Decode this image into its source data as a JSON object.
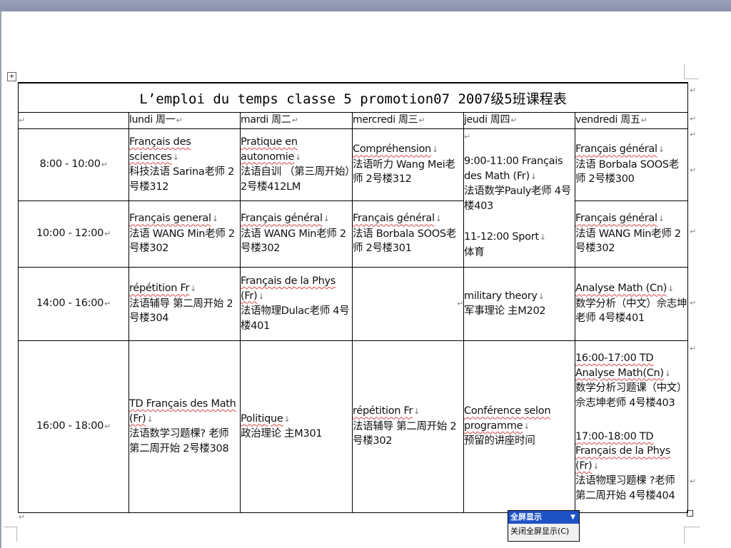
{
  "title": "L’emploi du temps classe 5 promotion07  2007级5班课程表",
  "days": [
    "lundi 周一",
    "mardi 周二",
    "mercredi 周三",
    "jeudi 周四",
    "vendredi 周五"
  ],
  "times": [
    "8:00 - 10:00",
    "10:00 - 12:00",
    "14:00 - 16:00",
    "16:00 - 18:00"
  ],
  "rows": [
    {
      "lundi": [
        "Français des sciences",
        "科技法语 Sarina老师 2号楼312"
      ],
      "mardi": [
        "Pratique en autonomie",
        "法语自训 （第三周开始）2号楼412LM"
      ],
      "mercredi": [
        "Compréhension",
        "法语听力 Wang Mei老师 2号楼312"
      ],
      "vendredi": [
        "Français général",
        "法语 Borbala SOOS老师 2号楼300"
      ]
    },
    {
      "lundi": [
        "Français general",
        "法语 WANG Min老师 2号楼302"
      ],
      "mardi": [
        "Français général",
        "法语 WANG Min老师 2号楼302"
      ],
      "mercredi": [
        "Français général",
        "法语 Borbala SOOS老师 2号楼301"
      ],
      "vendredi": [
        "Français général",
        "法语 WANG Min老师 2号楼302"
      ]
    },
    {
      "lundi": [
        "répétition Fr",
        "法语辅导 第二周开始 2号楼304"
      ],
      "mardi": [
        "Français de la Phys (Fr)",
        "法语物理Dulac老师 4号楼401"
      ],
      "mercredi": [
        "",
        ""
      ],
      "jeudi": [
        "military theory",
        "军事理论 主M202"
      ],
      "vendredi": [
        "Analyse Math (Cn)",
        "数学分析（中文）佘志坤老师 4号楼401"
      ]
    },
    {
      "lundi": [
        "TD Français des Math (Fr)",
        "法语数学习题棵? 老师 第二周开始 2号楼308"
      ],
      "mardi": [
        "Politique",
        "政治理论 主M301"
      ],
      "mercredi": [
        "répétition Fr",
        "法语辅导 第二周开始 2号楼302"
      ],
      "jeudi": [
        "Conférence selon programme",
        "预留的讲座时间"
      ],
      "vendredi_a": [
        "16:00-17:00 TD Analyse Math(Cn)",
        "数学分析习题课（中文）佘志坤老师 4号楼403"
      ],
      "vendredi_b": [
        "17:00-18:00 TD Français de la Phys (Fr)",
        "法语物理习题棵 ?老师 第二周开始 4号楼404"
      ]
    }
  ],
  "jeudi_morning": {
    "a": [
      "9:00-11:00 Français des Math (Fr)",
      "法语数学Pauly老师 4号楼403"
    ],
    "b": [
      "11-12:00 Sport",
      "体育"
    ]
  },
  "menu": {
    "title": "全屏显示",
    "item": "关闭全屏显示(C)"
  },
  "colors": {
    "titlebar": "#8a93ab",
    "menu_highlight": "#1f53c5",
    "spell_underline": "#dd4444"
  }
}
